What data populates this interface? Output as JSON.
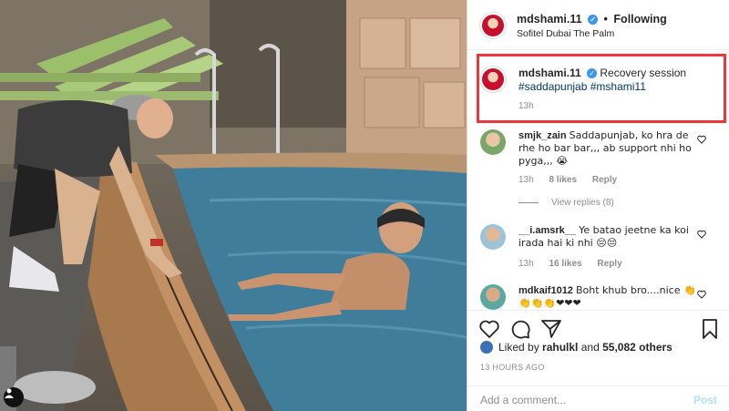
{
  "header": {
    "username": "mdshami.11",
    "separator": "•",
    "follow_status": "Following",
    "location": "Sofitel Dubai The Palm"
  },
  "caption": {
    "username": "mdshami.11",
    "text": "Recovery session",
    "hashtags": "#saddapunjab #mshami11",
    "time": "13h"
  },
  "comments": [
    {
      "username": "smjk_zain",
      "text": "Saddapunjab, ko hra de rhe ho bar bar,,, ab support nhi ho pyga,,, 😭",
      "time": "13h",
      "likes": "8 likes",
      "reply": "Reply",
      "view_replies": "View replies (8)"
    },
    {
      "username": "__i.amsrk__",
      "text": "Ye batao jeetne ka koi irada hai ki nhi 😔😔",
      "time": "13h",
      "likes": "16 likes",
      "reply": "Reply"
    },
    {
      "username": "mdkaif1012",
      "text": "Boht khub bro....nice 👏👏👏👏❤❤❤"
    }
  ],
  "likes": {
    "prefix": "Liked by",
    "user": "rahulkl",
    "suffix": "and",
    "others": "55,082 others"
  },
  "posted_ago": "13 HOURS AGO",
  "add_comment": {
    "placeholder": "Add a comment...",
    "post_label": "Post"
  },
  "colors": {
    "highlight": "#e8383a",
    "verified": "#3897f0",
    "hashtag": "#00376b"
  },
  "icons": [
    "verified-badge-icon",
    "heart-icon",
    "comment-icon",
    "share-icon",
    "bookmark-icon",
    "profile-icon"
  ]
}
